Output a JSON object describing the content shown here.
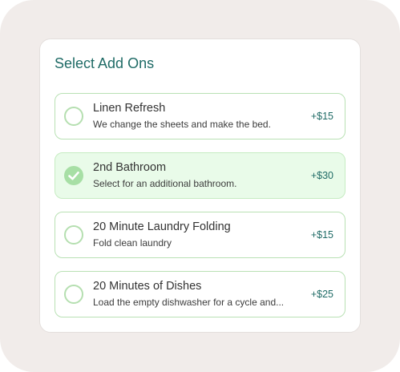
{
  "title": "Select Add Ons",
  "options": [
    {
      "name": "Linen Refresh",
      "description": "We change the sheets and make the bed.",
      "price": "+$15",
      "selected": false
    },
    {
      "name": "2nd Bathroom",
      "description": "Select for an additional bathroom.",
      "price": "+$30",
      "selected": true
    },
    {
      "name": "20 Minute Laundry Folding",
      "description": "Fold clean laundry",
      "price": "+$15",
      "selected": false
    },
    {
      "name": "20 Minutes of Dishes",
      "description": "Load the empty dishwasher for a cycle and...",
      "price": "+$25",
      "selected": false
    }
  ],
  "colors": {
    "accent": "#1f6b66",
    "border": "#b9e1b4",
    "selected_bg": "#e9fbe9",
    "check_fill": "#a7dfa5"
  }
}
